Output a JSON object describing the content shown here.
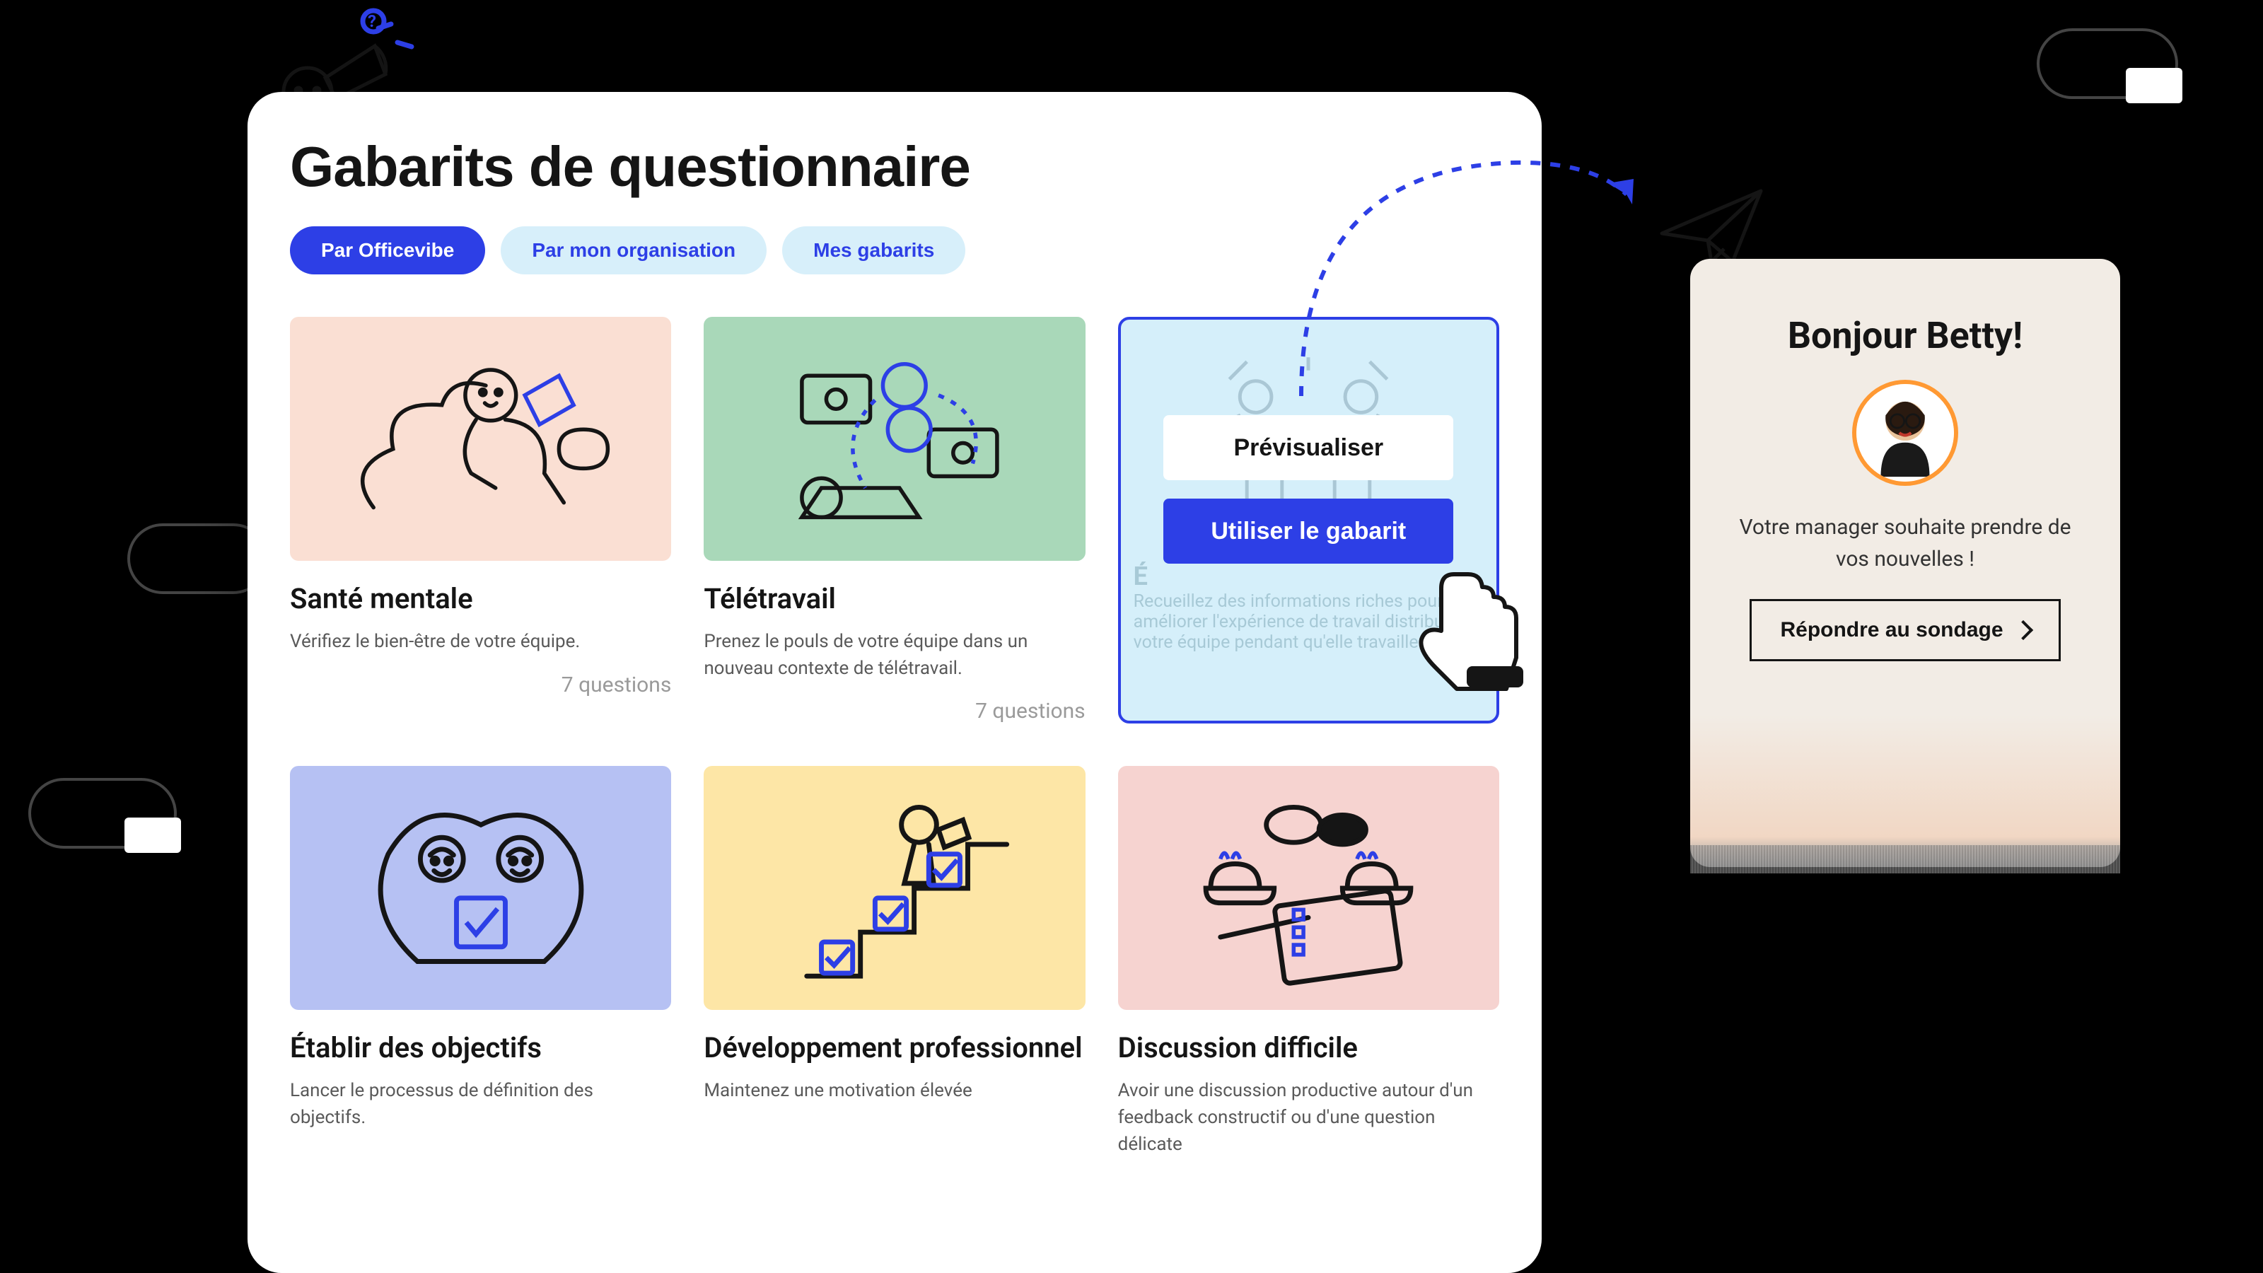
{
  "header": {
    "title": "Gabarits de questionnaire"
  },
  "tabs": [
    {
      "label": "Par Officevibe",
      "active": true
    },
    {
      "label": "Par mon organisation",
      "active": false
    },
    {
      "label": "Mes gabarits",
      "active": false
    }
  ],
  "cards": [
    {
      "title": "Santé mentale",
      "desc": "Vérifiez le bien-être de votre équipe.",
      "count": "7 questions"
    },
    {
      "title": "Télétravail",
      "desc": "Prenez le pouls de votre équipe dans un nouveau contexte de télétravail.",
      "count": "7 questions"
    },
    {
      "title": "É",
      "desc": "Recueillez des informations riches pour améliorer l'expérience de travail distribué de votre équipe pendant qu'elle travaille…",
      "count": ""
    },
    {
      "title": "Établir des objectifs",
      "desc": "Lancer le processus de définition des objectifs.",
      "count": ""
    },
    {
      "title": "Développement professionnel",
      "desc": "Maintenez une motivation élevée",
      "count": ""
    },
    {
      "title": "Discussion difficile",
      "desc": "Avoir une discussion productive autour d'un feedback constructif ou d'une question délicate",
      "count": ""
    }
  ],
  "hover": {
    "preview": "Prévisualiser",
    "use": "Utiliser le gabarit"
  },
  "notification": {
    "greeting": "Bonjour Betty!",
    "body": "Votre manager souhaite prendre de vos nouvelles !",
    "cta": "Répondre au sondage"
  },
  "colors": {
    "accent": "#2d3fe6"
  }
}
